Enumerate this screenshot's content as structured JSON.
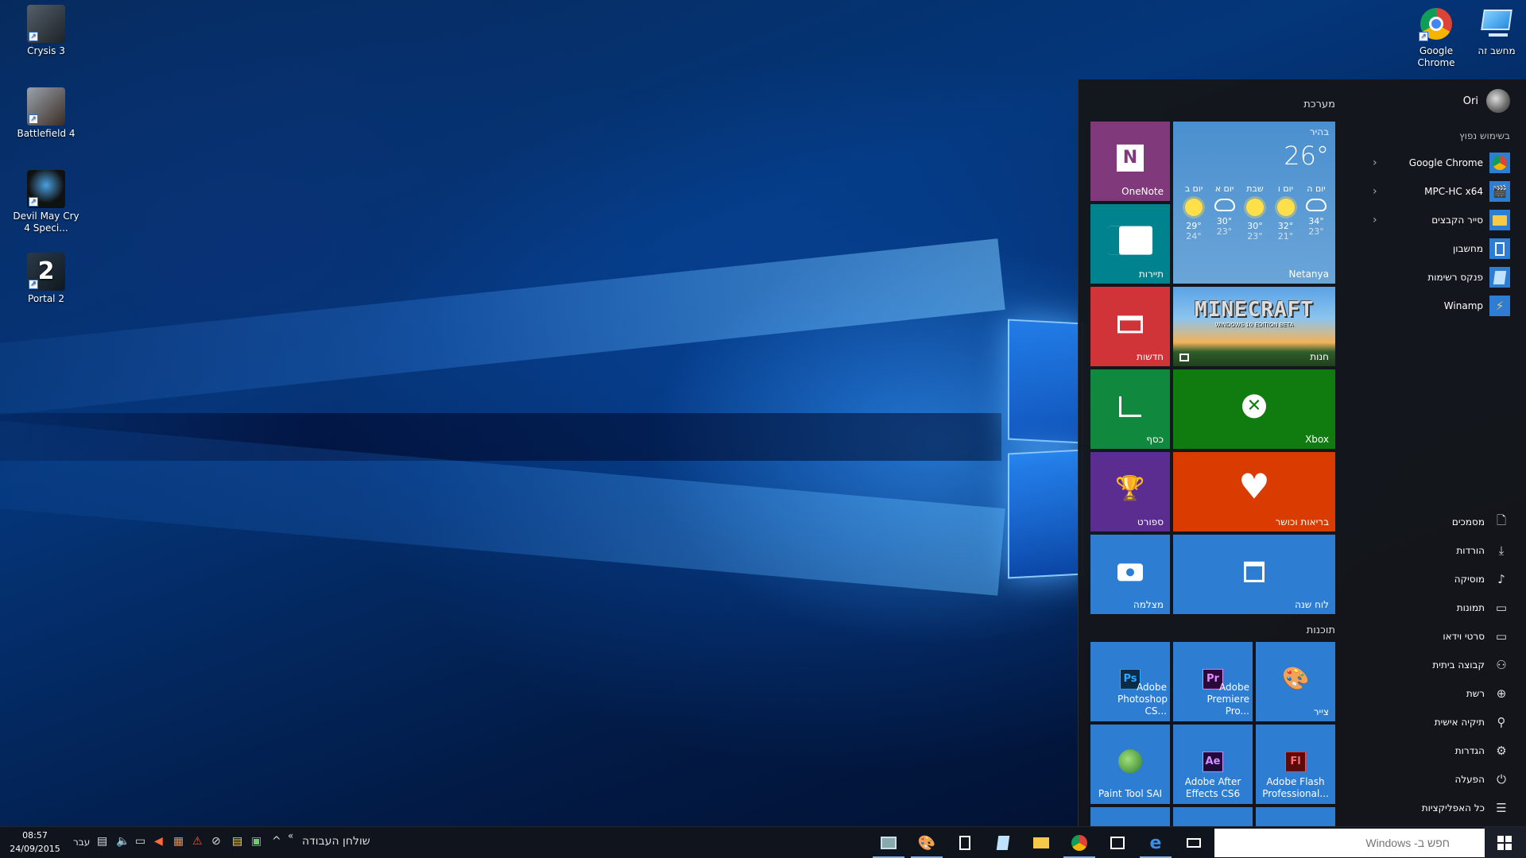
{
  "desktop": {
    "icons_left": [
      {
        "label": "Crysis 3",
        "pic": "crysis-3-icon"
      },
      {
        "label": "Battlefield 4",
        "pic": "battlefield-4-icon"
      },
      {
        "label": "Devil May Cry 4 Speci...",
        "pic": "devil-may-cry-icon"
      },
      {
        "label": "Portal 2",
        "pic": "portal-2-icon"
      }
    ],
    "icons_right": [
      {
        "label": "מחשב זה",
        "pic": "this-pc-icon"
      },
      {
        "label": "Google Chrome",
        "pic": "chrome-icon"
      }
    ]
  },
  "start": {
    "user": "Ori",
    "most_used_title": "בשימוש נפוץ",
    "most_used": [
      {
        "label": "Google Chrome",
        "icon": "chrome-icon",
        "has_arrow": true
      },
      {
        "label": "MPC-HC x64",
        "icon": "mpc-icon",
        "has_arrow": true
      },
      {
        "label": "סייר הקבצים",
        "icon": "folder-icon",
        "has_arrow": true
      },
      {
        "label": "מחשבון",
        "icon": "calculator-icon",
        "has_arrow": false
      },
      {
        "label": "פנקס רשימות",
        "icon": "notepad-icon",
        "has_arrow": false
      },
      {
        "label": "Winamp",
        "icon": "winamp-icon",
        "has_arrow": false
      }
    ],
    "places": [
      {
        "label": "מסמכים",
        "icon": "document-icon"
      },
      {
        "label": "הורדות",
        "icon": "download-icon"
      },
      {
        "label": "מוסיקה",
        "icon": "music-icon"
      },
      {
        "label": "תמונות",
        "icon": "pictures-icon"
      },
      {
        "label": "סרטי וידאו",
        "icon": "video-icon"
      },
      {
        "label": "קבוצה ביתית",
        "icon": "homegroup-icon"
      },
      {
        "label": "רשת",
        "icon": "network-icon"
      },
      {
        "label": "תיקיה אישית",
        "icon": "personal-folder-icon"
      },
      {
        "label": "הגדרות",
        "icon": "settings-icon"
      },
      {
        "label": "הפעלה",
        "icon": "power-icon"
      },
      {
        "label": "כל האפליקציות",
        "icon": "all-apps-icon"
      }
    ],
    "groups": {
      "system": "מערכת",
      "programs": "תוכנות"
    },
    "tiles": {
      "onenote": "OneNote",
      "travel": "תיירות",
      "news": "חדשות",
      "money": "כסף",
      "sports": "ספורט",
      "camera": "מצלמה",
      "minecraft": "MINECRAFT",
      "minecraft_sub": "WINDOWS 10 EDITION BETA",
      "store": "חנות",
      "xbox": "Xbox",
      "health": "בריאות וכושר",
      "calendar": "לוח שנה",
      "photoshop": "Adobe Photoshop CS...",
      "premiere": "Adobe Premiere Pro...",
      "paint": "צייר",
      "sai": "Paint Tool SAI",
      "aftereffects": "Adobe After Effects CS6",
      "flash": "Adobe Flash Professional...",
      "ps_badge": "Ps",
      "pr_badge": "Pr",
      "ae_badge": "Ae",
      "fl_badge": "Fl",
      "onenote_badge": "N"
    },
    "weather": {
      "condition": "בהיר",
      "temp": "26°",
      "location": "Netanya",
      "days": [
        {
          "name": "יום ה",
          "icon": "cloud",
          "hi": "34°",
          "lo": "23°"
        },
        {
          "name": "יום ו",
          "icon": "sun",
          "hi": "32°",
          "lo": "21°"
        },
        {
          "name": "שבת",
          "icon": "sun",
          "hi": "30°",
          "lo": "23°"
        },
        {
          "name": "יום א",
          "icon": "cloud",
          "hi": "30°",
          "lo": "23°"
        },
        {
          "name": "יום ב",
          "icon": "sun",
          "hi": "29°",
          "lo": "24°"
        }
      ]
    }
  },
  "taskbar": {
    "search_placeholder": "חפש ב- Windows",
    "time": "08:57",
    "date": "24/09/2015",
    "lang": "עבר",
    "desktop_label": "שולחן העבודה",
    "overflow": "«",
    "tray_up": "^"
  },
  "colors": {
    "onenote": "#80397b",
    "travel": "#00838f",
    "news": "#d13438",
    "money": "#10893e",
    "sports": "#5c2d91",
    "blue": "#2d7dd2",
    "xbox": "#107c10",
    "health": "#da3b01"
  }
}
